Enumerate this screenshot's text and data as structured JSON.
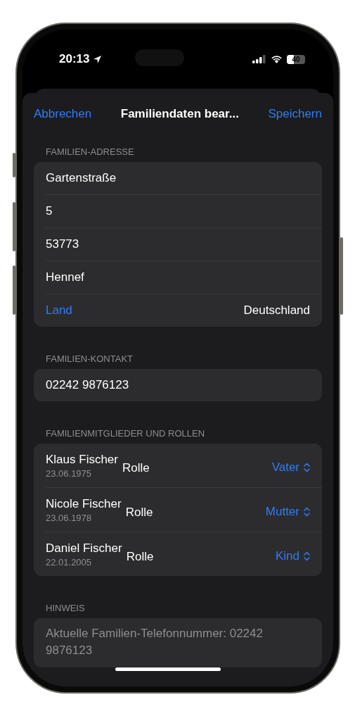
{
  "status_bar": {
    "time": "20:13",
    "battery": "40"
  },
  "nav": {
    "cancel": "Abbrechen",
    "title": "Familiendaten bear...",
    "save": "Speichern"
  },
  "sections": [
    {
      "header": "FAMILIEN-ADRESSE",
      "rows": [
        {
          "kind": "field",
          "value": "Gartenstraße"
        },
        {
          "kind": "field",
          "value": "5"
        },
        {
          "kind": "field",
          "value": "53773"
        },
        {
          "kind": "field",
          "value": "Hennef"
        },
        {
          "kind": "picker",
          "label": "Land",
          "value": "Deutschland"
        }
      ]
    },
    {
      "header": "FAMILIEN-KONTAKT",
      "rows": [
        {
          "kind": "field",
          "value": "02242 9876123"
        }
      ]
    },
    {
      "header": "FAMILIENMITGLIEDER UND ROLLEN",
      "rows": [
        {
          "kind": "member",
          "name": "Klaus Fischer",
          "date": "23.06.1975",
          "label": "Rolle",
          "value": "Vater"
        },
        {
          "kind": "member",
          "name": "Nicole Fischer",
          "date": "23.06.1978",
          "label": "Rolle",
          "value": "Mutter"
        },
        {
          "kind": "member",
          "name": "Daniel Fischer",
          "date": "22.01.2005",
          "label": "Rolle",
          "value": "Kind"
        }
      ]
    },
    {
      "header": "HINWEIS",
      "rows": [
        {
          "kind": "note",
          "value": "Aktuelle Familien-Telefonnummer: 02242 9876123"
        }
      ]
    }
  ]
}
